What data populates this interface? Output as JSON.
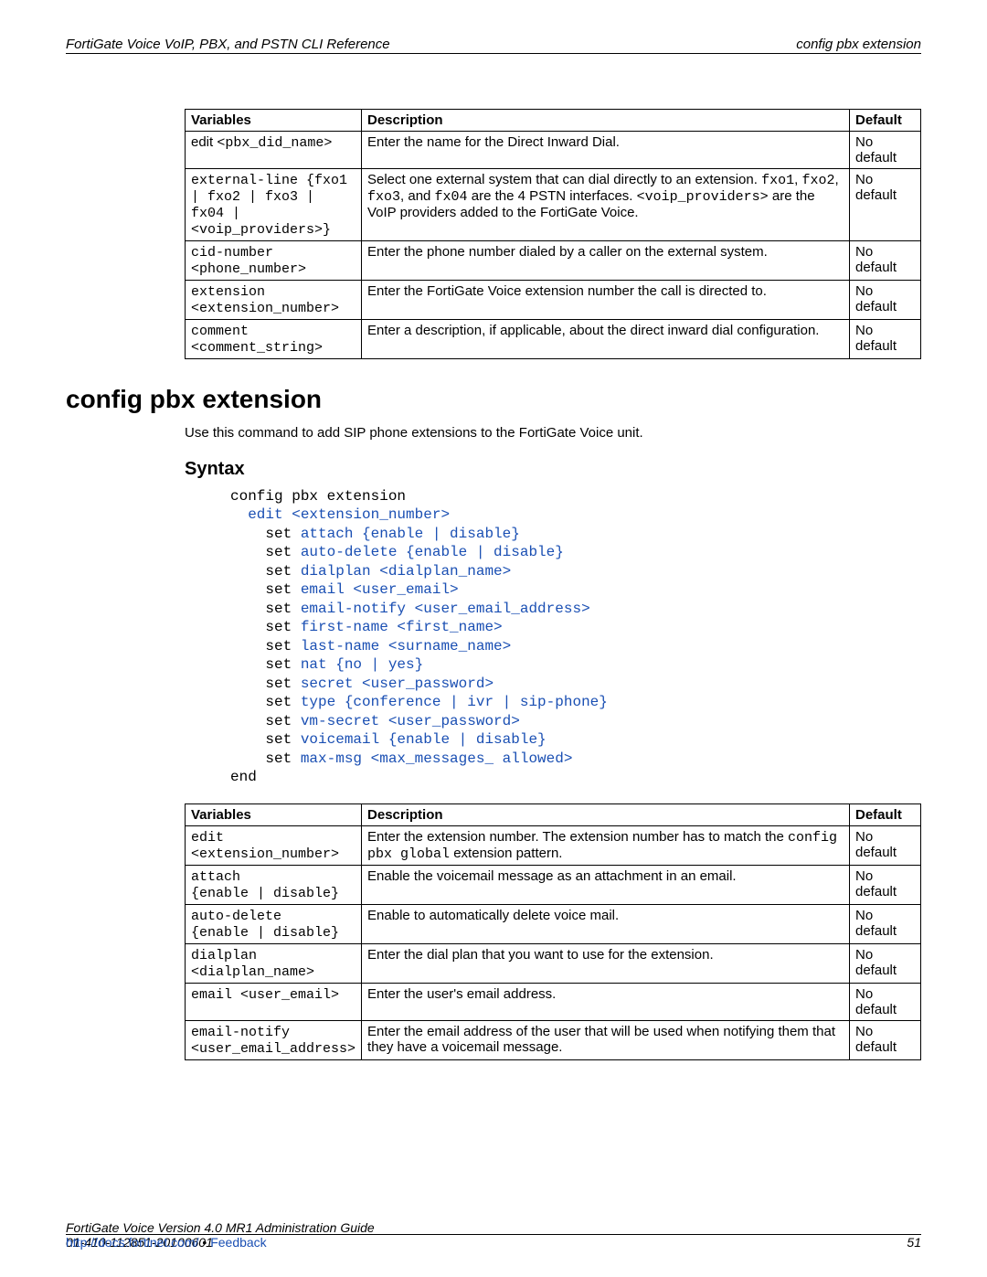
{
  "header": {
    "left": "FortiGate Voice VoIP, PBX, and PSTN CLI Reference",
    "right": "config pbx extension"
  },
  "table1": {
    "headers": [
      "Variables",
      "Description",
      "Default"
    ],
    "rows": [
      {
        "var_plain": "edit ",
        "var_mono": "<pbx_did_name>",
        "desc_parts": [
          {
            "t": "Enter the name for the Direct Inward Dial."
          }
        ],
        "def": "No default"
      },
      {
        "var_mono_full": "external-line {fxo1 | fxo2 | fxo3 | fx04 | <voip_providers>}",
        "desc_parts": [
          {
            "t": "Select one external system that can dial directly to an extension. "
          },
          {
            "m": "fxo1"
          },
          {
            "t": ", "
          },
          {
            "m": "fxo2"
          },
          {
            "t": ", "
          },
          {
            "m": "fxo3"
          },
          {
            "t": ", and "
          },
          {
            "m": "fx04"
          },
          {
            "t": " are the 4 PSTN interfaces. "
          },
          {
            "m": "<voip_providers>"
          },
          {
            "t": " are the VoIP providers added to the FortiGate Voice."
          }
        ],
        "def": "No default"
      },
      {
        "var_mono_full": "cid-number <phone_number>",
        "desc_parts": [
          {
            "t": "Enter the phone number dialed by a caller on the external system."
          }
        ],
        "def": "No default"
      },
      {
        "var_mono_full": "extension <extension_number>",
        "desc_parts": [
          {
            "t": "Enter the FortiGate Voice extension number the call is directed to."
          }
        ],
        "def": "No default"
      },
      {
        "var_mono_full": "comment <comment_string>",
        "desc_parts": [
          {
            "t": "Enter a description, if applicable, about the direct inward dial configuration."
          }
        ],
        "def": "No default"
      }
    ]
  },
  "section_title": "config pbx extension",
  "intro_text": "Use this command to add SIP phone extensions to the FortiGate Voice unit.",
  "syntax_heading": "Syntax",
  "syntax_lines": [
    [
      {
        "t": "config pbx extension"
      }
    ],
    [
      {
        "t": "  "
      },
      {
        "b": "edit <extension_number>"
      }
    ],
    [
      {
        "t": "    set "
      },
      {
        "b": "attach {enable | disable}"
      }
    ],
    [
      {
        "t": "    set "
      },
      {
        "b": "auto-delete {enable | disable}"
      }
    ],
    [
      {
        "t": "    set "
      },
      {
        "b": "dialplan <dialplan_name>"
      }
    ],
    [
      {
        "t": "    set "
      },
      {
        "b": "email <user_email>"
      }
    ],
    [
      {
        "t": "    set "
      },
      {
        "b": "email-notify <user_email_address>"
      }
    ],
    [
      {
        "t": "    set "
      },
      {
        "b": "first-name <first_name>"
      }
    ],
    [
      {
        "t": "    set "
      },
      {
        "b": "last-name <surname_name>"
      }
    ],
    [
      {
        "t": "    set "
      },
      {
        "b": "nat {no | yes}"
      }
    ],
    [
      {
        "t": "    set "
      },
      {
        "b": "secret <user_password>"
      }
    ],
    [
      {
        "t": "    set "
      },
      {
        "b": "type {conference | ivr | sip-phone}"
      }
    ],
    [
      {
        "t": "    set "
      },
      {
        "b": "vm-secret <user_password>"
      }
    ],
    [
      {
        "t": "    set "
      },
      {
        "b": "voicemail {enable | disable}"
      }
    ],
    [
      {
        "t": "    set "
      },
      {
        "b": "max-msg <max_messages_ allowed>"
      }
    ],
    [
      {
        "t": "end"
      }
    ]
  ],
  "table2": {
    "headers": [
      "Variables",
      "Description",
      "Default"
    ],
    "rows": [
      {
        "var_mono_full": "edit <extension_number>",
        "desc_parts": [
          {
            "t": "Enter the extension number. The extension number has to match the "
          },
          {
            "m": "config pbx global"
          },
          {
            "t": " extension pattern."
          }
        ],
        "def": "No default"
      },
      {
        "var_mono_full": "attach\n{enable | disable}",
        "desc_parts": [
          {
            "t": "Enable the voicemail message as an attachment in an email."
          }
        ],
        "def": "No default"
      },
      {
        "var_mono_full": "auto-delete\n{enable | disable}",
        "desc_parts": [
          {
            "t": "Enable to automatically delete voice mail."
          }
        ],
        "def": "No default"
      },
      {
        "var_mono_full": "dialplan <dialplan_name>",
        "desc_parts": [
          {
            "t": "Enter the dial plan that you want to use for the extension."
          }
        ],
        "def": "No default"
      },
      {
        "var_mono_full": "email <user_email>",
        "desc_parts": [
          {
            "t": "Enter the user's email address."
          }
        ],
        "def": "No default"
      },
      {
        "var_mono_full": "email-notify <user_email_address>",
        "desc_parts": [
          {
            "t": "Enter the email address of the user that will be used when notifying them that they have a voicemail message."
          }
        ],
        "def": "No default"
      }
    ]
  },
  "footer": {
    "line1": "FortiGate Voice Version 4.0 MR1 Administration Guide",
    "line2": "01-410-112851-20100601",
    "link": "http://docs.fortinet.com/",
    "dot": " • ",
    "feedback": "Feedback",
    "pagenum": "51"
  }
}
